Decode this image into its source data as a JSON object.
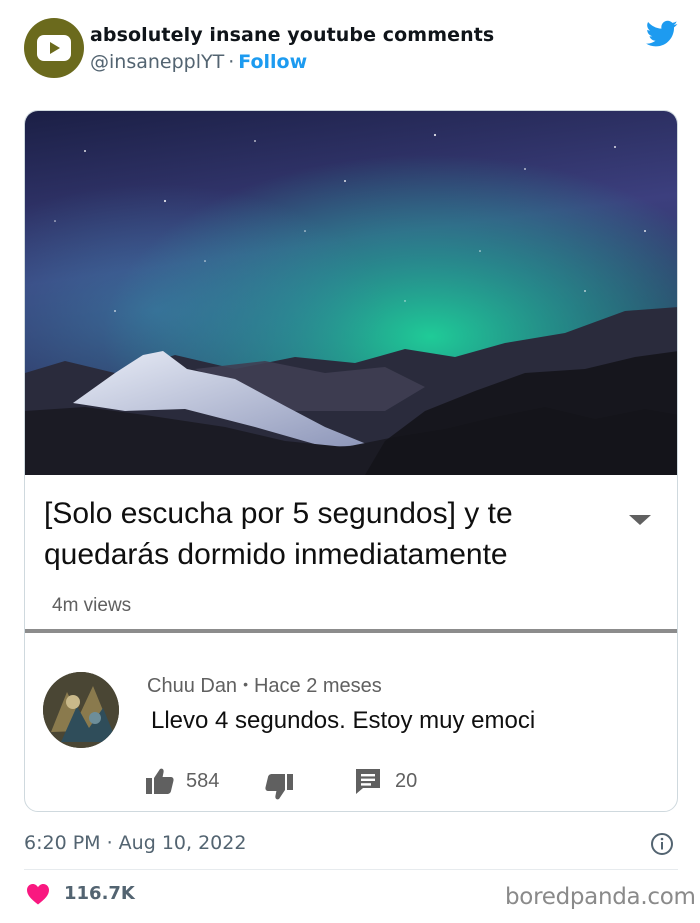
{
  "tweet": {
    "account_name": "absolutely insane youtube comments",
    "handle": "@insanepplYT",
    "separator": "·",
    "follow_label": "Follow",
    "timestamp": "6:20 PM · Aug 10, 2022",
    "likes": "116.7K",
    "icons": [
      "youtube-logo-icon",
      "twitter-bird-icon",
      "info-icon",
      "heart-icon"
    ]
  },
  "video": {
    "title": "[Solo escucha por 5 segundos] y te quedarás dormido inmediatamente",
    "views": "4m views"
  },
  "comment": {
    "author": "Chuu Dan",
    "dot": "•",
    "time": "Hace 2 meses",
    "text": "Llevo 4 segundos. Estoy muy emoci",
    "like_count": "584",
    "reply_count": "20",
    "icons": [
      "thumbs-up-icon",
      "thumbs-down-icon",
      "reply-icon"
    ]
  },
  "watermark": "boredpanda.com",
  "colors": {
    "twitter_blue": "#1d9bf0",
    "heart": "#f91880",
    "aurora": "#1ed39a",
    "avatar_olive": "#6b6a1d"
  }
}
